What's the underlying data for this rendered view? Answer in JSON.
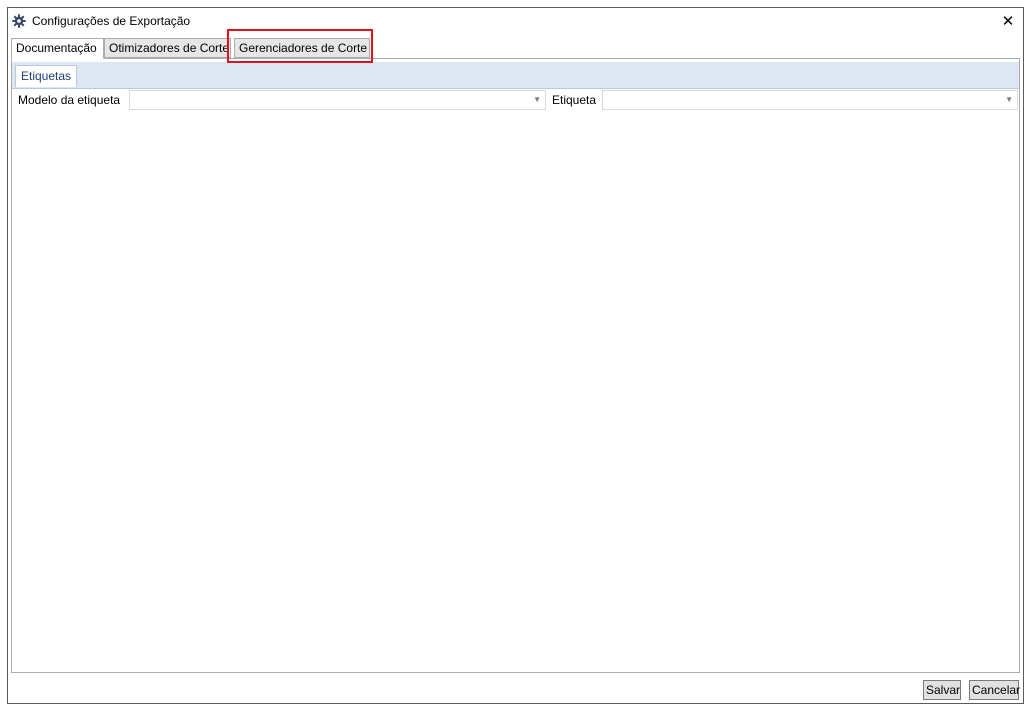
{
  "window": {
    "title": "Configurações de Exportação",
    "icon": "gear-icon",
    "close_glyph": "✕"
  },
  "tabs": [
    {
      "label": "Documentação",
      "active": true
    },
    {
      "label": "Otimizadores de Corte",
      "active": false
    },
    {
      "label": "Gerenciadores de Corte",
      "active": false,
      "highlighted": true
    }
  ],
  "subtabs": [
    {
      "label": "Etiquetas",
      "active": true
    }
  ],
  "form": {
    "modelo_label": "Modelo da etiqueta",
    "modelo_value": "",
    "etiqueta_label": "Etiqueta",
    "etiqueta_value": "",
    "dropdown_glyph": "▼"
  },
  "footer": {
    "save_label": "Salvar",
    "cancel_label": "Cancelar"
  },
  "colors": {
    "highlight": "#e0121d",
    "subtab_strip": "#dde7f3"
  }
}
